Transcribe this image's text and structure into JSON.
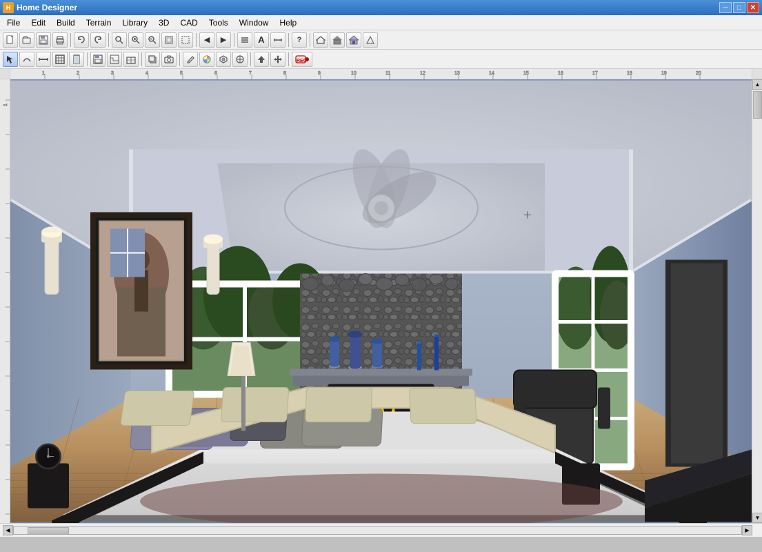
{
  "app": {
    "title": "Home Designer",
    "icon": "H"
  },
  "window_controls": {
    "minimize": "─",
    "maximize": "□",
    "close": "✕"
  },
  "menu": {
    "items": [
      "File",
      "Edit",
      "Build",
      "Terrain",
      "Library",
      "3D",
      "CAD",
      "Tools",
      "Window",
      "Help"
    ]
  },
  "toolbar1": {
    "buttons": [
      {
        "name": "new",
        "icon": "📄"
      },
      {
        "name": "open",
        "icon": "📂"
      },
      {
        "name": "save",
        "icon": "💾"
      },
      {
        "name": "print",
        "icon": "🖨"
      },
      {
        "name": "undo",
        "icon": "↩"
      },
      {
        "name": "redo",
        "icon": "↪"
      },
      {
        "name": "find",
        "icon": "🔍"
      },
      {
        "name": "zoom-in",
        "icon": "⊕"
      },
      {
        "name": "zoom-out",
        "icon": "⊖"
      },
      {
        "name": "zoom-fit",
        "icon": "⊞"
      },
      {
        "name": "zoom-area",
        "icon": "⊟"
      },
      {
        "name": "nav1",
        "icon": "◁"
      },
      {
        "name": "nav2",
        "icon": "▷"
      },
      {
        "name": "layer",
        "icon": "≡"
      },
      {
        "name": "text",
        "icon": "T"
      },
      {
        "name": "measure",
        "icon": "↔"
      },
      {
        "name": "help-btn",
        "icon": "?"
      },
      {
        "name": "house1",
        "icon": "⌂"
      },
      {
        "name": "house2",
        "icon": "⌂"
      },
      {
        "name": "house3",
        "icon": "⌂"
      },
      {
        "name": "house4",
        "icon": "⌂"
      }
    ]
  },
  "toolbar2": {
    "buttons": [
      {
        "name": "select",
        "icon": "↖"
      },
      {
        "name": "polyline",
        "icon": "⌒"
      },
      {
        "name": "dimension",
        "icon": "⊣"
      },
      {
        "name": "wall",
        "icon": "▦"
      },
      {
        "name": "door",
        "icon": "▣"
      },
      {
        "name": "save2",
        "icon": "💾"
      },
      {
        "name": "stairs",
        "icon": "⊞"
      },
      {
        "name": "cabinet",
        "icon": "▤"
      },
      {
        "name": "copy",
        "icon": "⎘"
      },
      {
        "name": "camera",
        "icon": "📷"
      },
      {
        "name": "paint",
        "icon": "🖌"
      },
      {
        "name": "color",
        "icon": "🎨"
      },
      {
        "name": "material",
        "icon": "◈"
      },
      {
        "name": "symbol",
        "icon": "⊕"
      },
      {
        "name": "arrow",
        "icon": "↑"
      },
      {
        "name": "move",
        "icon": "✛"
      },
      {
        "name": "record",
        "icon": "⏺"
      }
    ]
  },
  "statusbar": {
    "text": ""
  },
  "scene": {
    "description": "3D bedroom interior with fireplace and stone wall"
  }
}
